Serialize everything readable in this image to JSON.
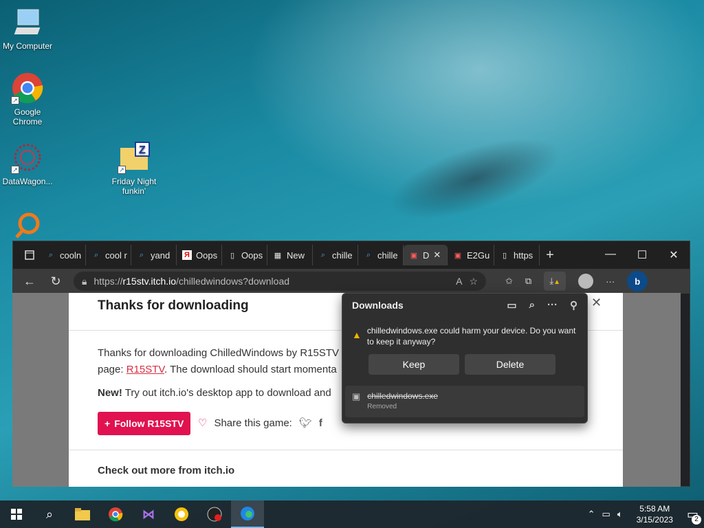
{
  "desktop": {
    "icons": [
      {
        "label": "My Computer"
      },
      {
        "label": "Google Chrome"
      },
      {
        "label": "DataWagon..."
      },
      {
        "label": "Friday Night funkin'"
      }
    ]
  },
  "browser": {
    "tabs": [
      {
        "label": "cooln",
        "icon": "search-icon"
      },
      {
        "label": "cool r",
        "icon": "search-icon"
      },
      {
        "label": "yand",
        "icon": "search-icon"
      },
      {
        "label": "Oops",
        "icon": "yandex-icon"
      },
      {
        "label": "Oops",
        "icon": "page-icon"
      },
      {
        "label": "New",
        "icon": "calendar-icon"
      },
      {
        "label": "chille",
        "icon": "search-icon"
      },
      {
        "label": "chille",
        "icon": "search-icon"
      },
      {
        "label": "D",
        "icon": "itch-icon",
        "active": true
      },
      {
        "label": "E2Gu",
        "icon": "itch-icon"
      },
      {
        "label": "https",
        "icon": "page-icon"
      }
    ],
    "address": {
      "prefix": "https://",
      "host": "r15stv.itch.io",
      "path": "/chilledwindows?download"
    }
  },
  "page": {
    "heading": "Thanks for downloading",
    "line1": "Thanks for downloading ChilledWindows by R15STV",
    "line2_prefix": "page: ",
    "line2_link": "R15STV",
    "line2_suffix": ". The download should start momenta",
    "new_label": "New!",
    "new_text": " Try out itch.io's desktop app to download and",
    "follow_label": "Follow R15STV",
    "share_label": "Share this game:",
    "checkout": "Check out more from itch.io"
  },
  "downloads": {
    "title": "Downloads",
    "warning": "chilledwindows.exe could harm your device. Do you want to keep it anyway?",
    "keep_label": "Keep",
    "delete_label": "Delete",
    "file_name": "chilledwindows.exe",
    "file_status": "Removed"
  },
  "taskbar": {
    "time": "5:58 AM",
    "date": "3/15/2023",
    "notifications": "2"
  }
}
